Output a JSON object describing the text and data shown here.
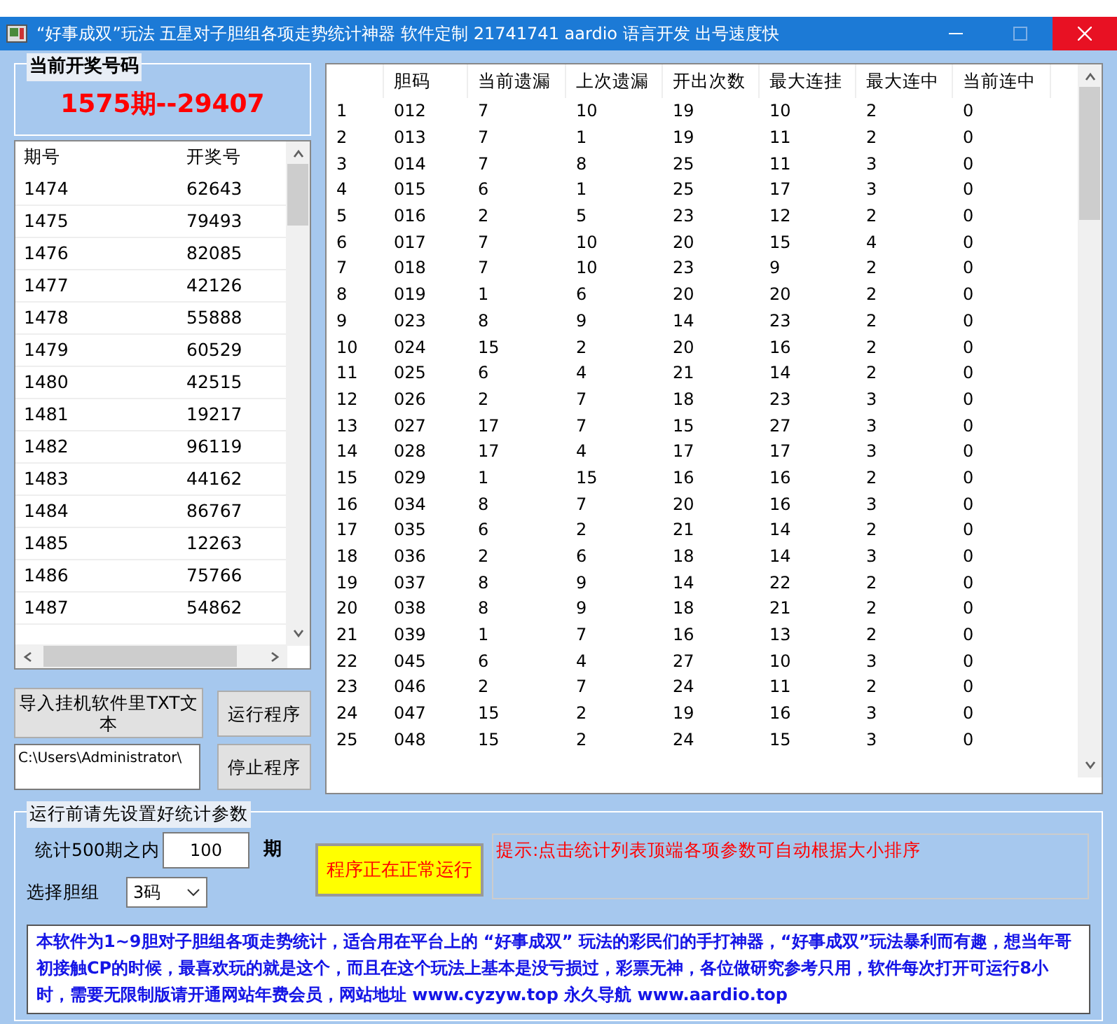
{
  "window": {
    "title": "“好事成双”玩法 五星对子胆组各项走势统计神器 软件定制 21741741 aardio 语言开发 出号速度快"
  },
  "current_draw": {
    "label": "当前开奖号码",
    "value": "1575期--29407"
  },
  "draw_list": {
    "columns": [
      "期号",
      "开奖号"
    ],
    "rows": [
      [
        "1474",
        "62643"
      ],
      [
        "1475",
        "79493"
      ],
      [
        "1476",
        "82085"
      ],
      [
        "1477",
        "42126"
      ],
      [
        "1478",
        "55888"
      ],
      [
        "1479",
        "60529"
      ],
      [
        "1480",
        "42515"
      ],
      [
        "1481",
        "19217"
      ],
      [
        "1482",
        "96119"
      ],
      [
        "1483",
        "44162"
      ],
      [
        "1484",
        "86767"
      ],
      [
        "1485",
        "12263"
      ],
      [
        "1486",
        "75766"
      ],
      [
        "1487",
        "54862"
      ]
    ]
  },
  "import_button": "导入挂机软件里TXT文本",
  "run_button": "运行程序",
  "path_field": {
    "value": "C:\\Users\\Administrator\\"
  },
  "stop_button": "停止程序",
  "stats_table": {
    "columns": [
      "",
      "胆码",
      "当前遗漏",
      "上次遗漏",
      "开出次数",
      "最大连挂",
      "最大连中",
      "当前连中"
    ],
    "rows": [
      [
        "1",
        "012",
        "7",
        "10",
        "19",
        "10",
        "2",
        "0"
      ],
      [
        "2",
        "013",
        "7",
        "1",
        "19",
        "11",
        "2",
        "0"
      ],
      [
        "3",
        "014",
        "7",
        "8",
        "25",
        "11",
        "3",
        "0"
      ],
      [
        "4",
        "015",
        "6",
        "1",
        "25",
        "17",
        "3",
        "0"
      ],
      [
        "5",
        "016",
        "2",
        "5",
        "23",
        "12",
        "2",
        "0"
      ],
      [
        "6",
        "017",
        "7",
        "10",
        "20",
        "15",
        "4",
        "0"
      ],
      [
        "7",
        "018",
        "7",
        "10",
        "23",
        "9",
        "2",
        "0"
      ],
      [
        "8",
        "019",
        "1",
        "6",
        "20",
        "20",
        "2",
        "0"
      ],
      [
        "9",
        "023",
        "8",
        "9",
        "14",
        "23",
        "2",
        "0"
      ],
      [
        "10",
        "024",
        "15",
        "2",
        "20",
        "16",
        "2",
        "0"
      ],
      [
        "11",
        "025",
        "6",
        "4",
        "21",
        "14",
        "2",
        "0"
      ],
      [
        "12",
        "026",
        "2",
        "7",
        "18",
        "23",
        "3",
        "0"
      ],
      [
        "13",
        "027",
        "17",
        "7",
        "15",
        "27",
        "3",
        "0"
      ],
      [
        "14",
        "028",
        "17",
        "4",
        "17",
        "17",
        "3",
        "0"
      ],
      [
        "15",
        "029",
        "1",
        "15",
        "16",
        "16",
        "2",
        "0"
      ],
      [
        "16",
        "034",
        "8",
        "7",
        "20",
        "16",
        "3",
        "0"
      ],
      [
        "17",
        "035",
        "6",
        "2",
        "21",
        "14",
        "2",
        "0"
      ],
      [
        "18",
        "036",
        "2",
        "6",
        "18",
        "14",
        "3",
        "0"
      ],
      [
        "19",
        "037",
        "8",
        "9",
        "14",
        "22",
        "2",
        "0"
      ],
      [
        "20",
        "038",
        "8",
        "9",
        "18",
        "21",
        "2",
        "0"
      ],
      [
        "21",
        "039",
        "1",
        "7",
        "16",
        "13",
        "2",
        "0"
      ],
      [
        "22",
        "045",
        "6",
        "4",
        "27",
        "10",
        "3",
        "0"
      ],
      [
        "23",
        "046",
        "2",
        "7",
        "24",
        "11",
        "2",
        "0"
      ],
      [
        "24",
        "047",
        "15",
        "2",
        "19",
        "16",
        "3",
        "0"
      ],
      [
        "25",
        "048",
        "15",
        "2",
        "24",
        "15",
        "3",
        "0"
      ]
    ]
  },
  "settings": {
    "title": "运行前请先设置好统计参数",
    "period_label": "统计500期之内",
    "period_value": "100",
    "period_unit": "期",
    "group_label": "选择胆组",
    "group_value": "3码",
    "status": "程序正在正常运行",
    "hint": "提示:点击统计列表顶端各项参数可自动根据大小排序",
    "description": "本软件为1~9胆对子胆组各项走势统计，适合用在平台上的 “好事成双” 玩法的彩民们的手打神器，“好事成双”玩法暴利而有趣，想当年哥初接触CP的时候，最喜欢玩的就是这个，而且在这个玩法上基本是没亏损过，彩票无神，各位做研究参考只用，软件每次打开可运行8小时，需要无限制版请开通网站年费会员，网站地址 www.cyzyw.top 永久导航 www.aardio.top"
  }
}
